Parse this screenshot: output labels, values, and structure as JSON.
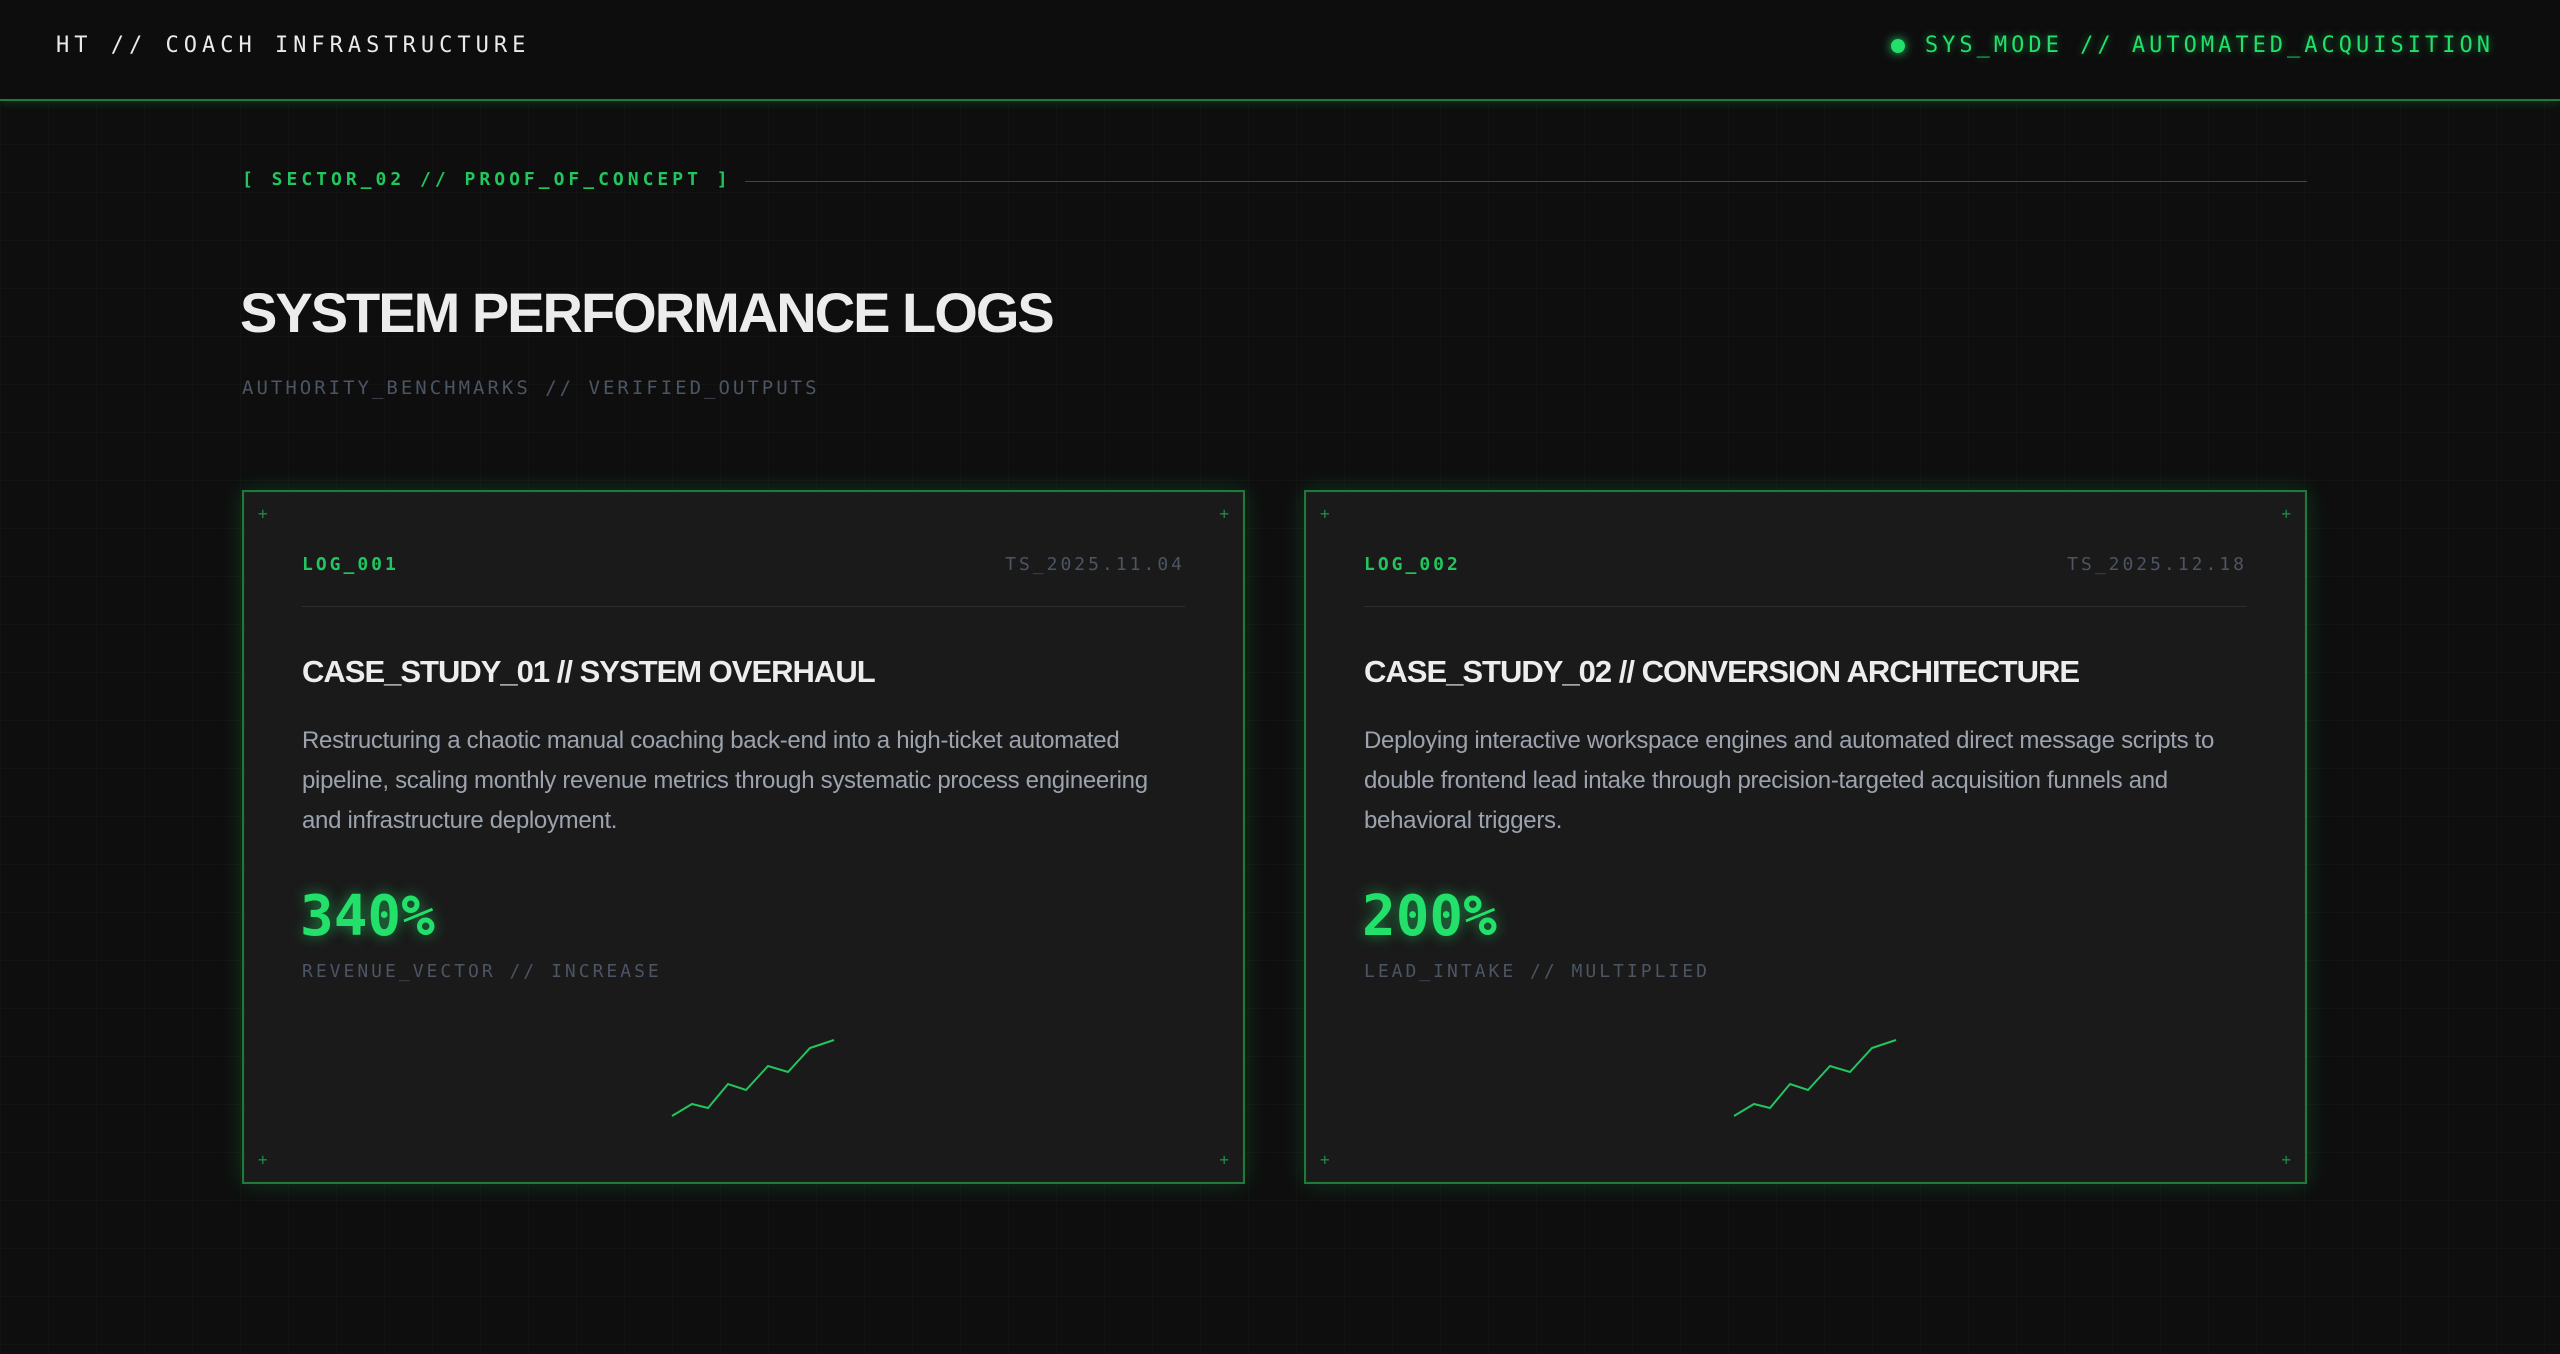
{
  "header": {
    "brand": "HT // COACH INFRASTRUCTURE",
    "status": "SYS_MODE // AUTOMATED_ACQUISITION"
  },
  "section": {
    "sector_label": "[ SECTOR_02 // PROOF_OF_CONCEPT ]",
    "title": "SYSTEM PERFORMANCE LOGS",
    "subtitle": "AUTHORITY_BENCHMARKS // VERIFIED_OUTPUTS"
  },
  "cards": [
    {
      "log_id": "LOG_001",
      "timestamp": "TS_2025.11.04",
      "title": "CASE_STUDY_01 // SYSTEM OVERHAUL",
      "description": "Restructuring a chaotic manual coaching back-end into a high-ticket automated pipeline, scaling monthly revenue metrics through systematic process engineering and infrastructure deployment.",
      "metric": "340%",
      "metric_label": "REVENUE_VECTOR // INCREASE",
      "icon": "sparkline-icon"
    },
    {
      "log_id": "LOG_002",
      "timestamp": "TS_2025.12.18",
      "title": "CASE_STUDY_02 // CONVERSION ARCHITECTURE",
      "description": "Deploying interactive workspace engines and automated direct message scripts to double frontend lead intake through precision-targeted acquisition funnels and behavioral triggers.",
      "metric": "200%",
      "metric_label": "LEAD_INTAKE // MULTIPLIED",
      "icon": "sparkline-icon"
    }
  ],
  "colors": {
    "accent": "#22e06a",
    "border": "#1f7a3a",
    "background": "#0e0e0e",
    "card": "#1a1a1a",
    "muted": "#4b5563"
  }
}
